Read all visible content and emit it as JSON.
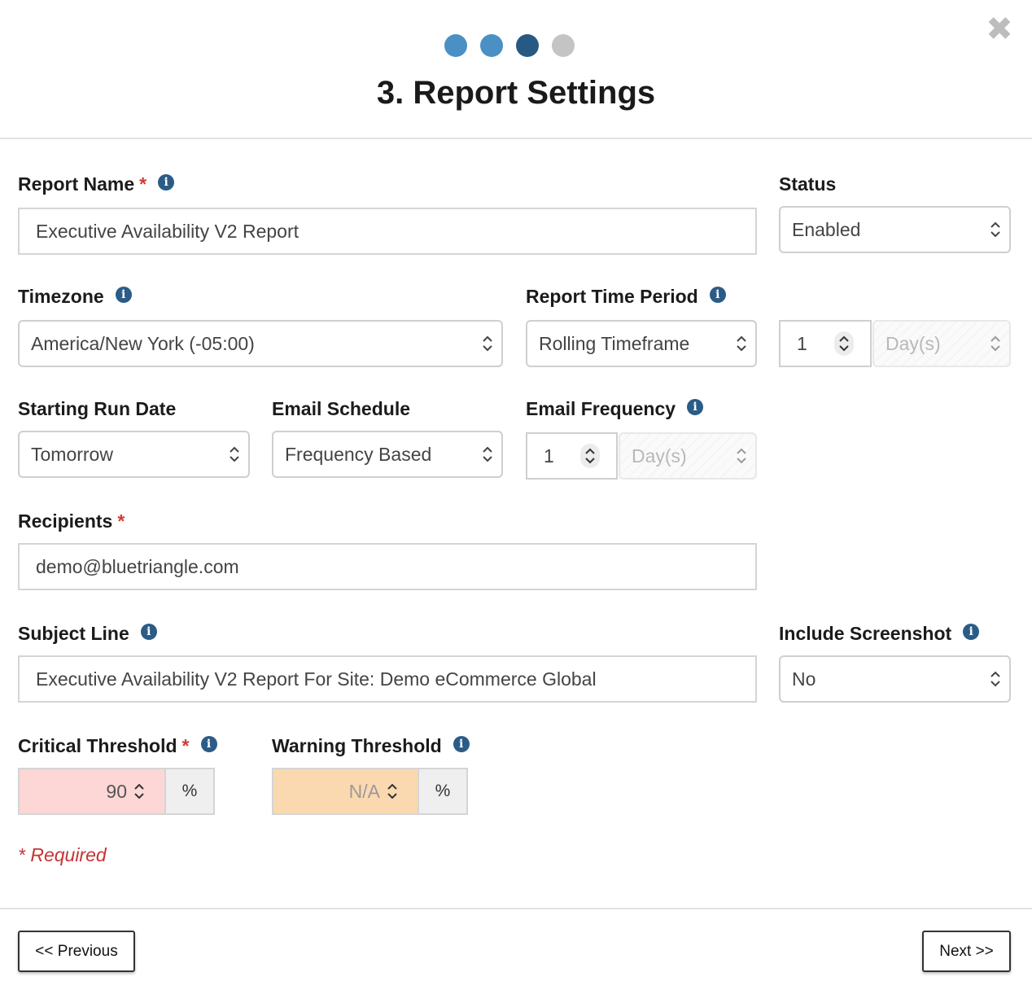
{
  "wizard": {
    "steps": [
      {
        "state": "done",
        "color": "#4a90c4"
      },
      {
        "state": "done",
        "color": "#4a90c4"
      },
      {
        "state": "current",
        "color": "#265a84"
      },
      {
        "state": "todo",
        "color": "#c4c4c4"
      }
    ],
    "title": "3. Report Settings",
    "close_icon": "close-icon"
  },
  "fields": {
    "report_name": {
      "label": "Report Name",
      "required_mark": "*",
      "value": "Executive Availability V2 Report"
    },
    "status": {
      "label": "Status",
      "value": "Enabled"
    },
    "timezone": {
      "label": "Timezone",
      "value": "America/New York (-05:00)"
    },
    "report_time_period": {
      "label": "Report Time Period",
      "value": "Rolling Timeframe",
      "amount": "1",
      "unit": "Day(s)"
    },
    "starting_run_date": {
      "label": "Starting Run Date",
      "value": "Tomorrow"
    },
    "email_schedule": {
      "label": "Email Schedule",
      "value": "Frequency Based"
    },
    "email_frequency": {
      "label": "Email Frequency",
      "amount": "1",
      "unit": "Day(s)"
    },
    "recipients": {
      "label": "Recipients",
      "required_mark": "*",
      "value": "demo@bluetriangle.com"
    },
    "subject_line": {
      "label": "Subject Line",
      "value": "Executive Availability V2 Report For Site: Demo eCommerce Global"
    },
    "include_screenshot": {
      "label": "Include Screenshot",
      "value": "No"
    },
    "critical_threshold": {
      "label": "Critical Threshold",
      "required_mark": "*",
      "value": "90",
      "unit": "%",
      "color": "#fdd6d6"
    },
    "warning_threshold": {
      "label": "Warning Threshold",
      "value": "N/A",
      "unit": "%",
      "color": "#fbd9b0"
    }
  },
  "required_note": "* Required",
  "footer": {
    "previous_label": "<< Previous",
    "next_label": "Next >>"
  }
}
